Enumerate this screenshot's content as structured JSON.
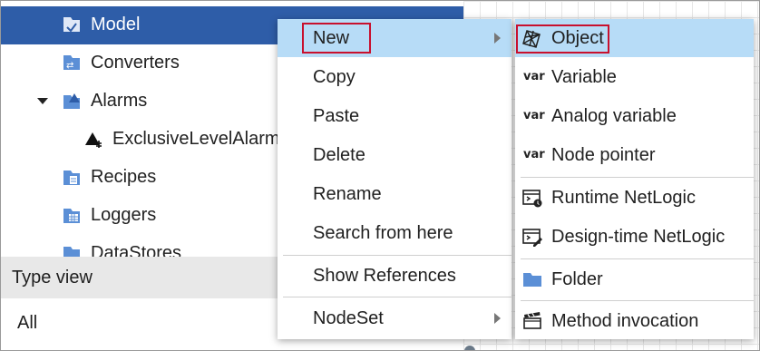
{
  "tree": {
    "items": [
      {
        "label": "Model",
        "icon": "model-icon",
        "selected": true
      },
      {
        "label": "Converters",
        "icon": "converters-icon"
      },
      {
        "label": "Alarms",
        "icon": "alarms-folder-icon",
        "expanded": true
      },
      {
        "label": "ExclusiveLevelAlarm",
        "icon": "level-alarm-icon"
      },
      {
        "label": "Recipes",
        "icon": "recipes-icon"
      },
      {
        "label": "Loggers",
        "icon": "loggers-icon"
      },
      {
        "label": "DataStores",
        "icon": "datastores-icon"
      }
    ]
  },
  "type_view": {
    "header": "Type view",
    "value": "All"
  },
  "context_menu": {
    "items": [
      {
        "label": "New",
        "has_submenu": true,
        "highlighted": true
      },
      {
        "label": "Copy"
      },
      {
        "label": "Paste"
      },
      {
        "label": "Delete"
      },
      {
        "label": "Rename"
      },
      {
        "label": "Search from here"
      },
      {
        "label": "Show References"
      },
      {
        "label": "NodeSet",
        "has_submenu": true
      }
    ]
  },
  "submenu": {
    "var_tag": "var",
    "items": [
      {
        "label": "Object",
        "icon": "object-icon",
        "highlighted": true
      },
      {
        "label": "Variable",
        "icon": "var"
      },
      {
        "label": "Analog variable",
        "icon": "var"
      },
      {
        "label": "Node pointer",
        "icon": "var"
      },
      {
        "label": "Runtime NetLogic",
        "icon": "runtime-netlogic-icon"
      },
      {
        "label": "Design-time NetLogic",
        "icon": "designtime-netlogic-icon"
      },
      {
        "label": "Folder",
        "icon": "folder-icon"
      },
      {
        "label": "Method invocation",
        "icon": "method-invocation-icon"
      }
    ]
  },
  "colors": {
    "selection": "#2e5da8",
    "hover": "#b7dcf7",
    "annotation_box": "#c8102e",
    "icon_blue": "#5b8fd6"
  }
}
